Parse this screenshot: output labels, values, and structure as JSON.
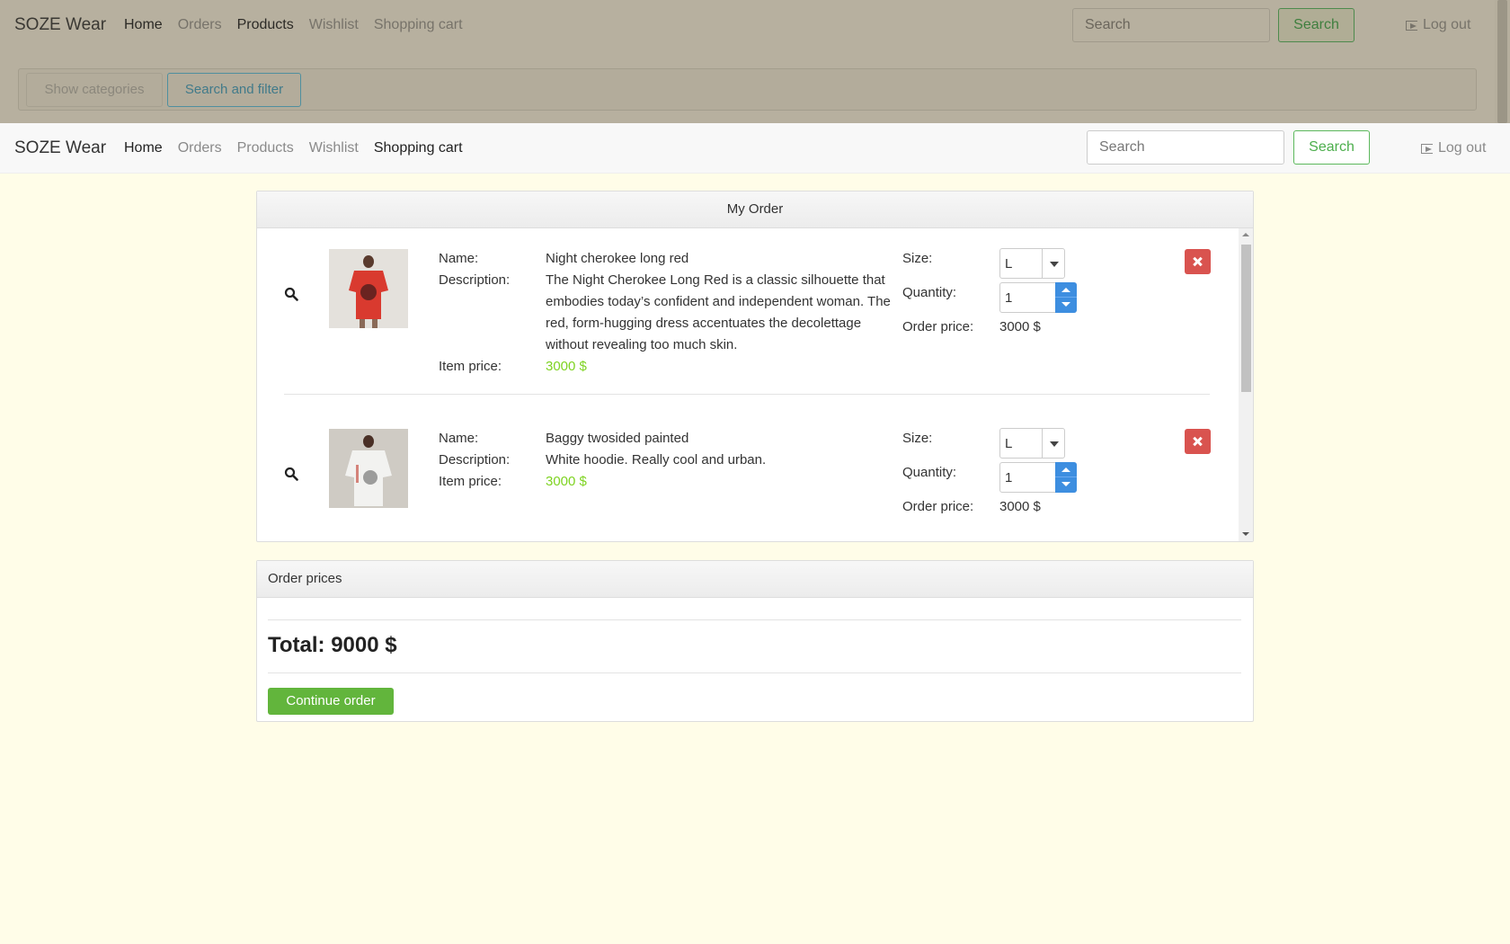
{
  "brand": "SOZE Wear",
  "nav": {
    "home": "Home",
    "orders": "Orders",
    "products": "Products",
    "wishlist": "Wishlist",
    "cart": "Shopping cart",
    "search_placeholder": "Search",
    "search_button": "Search",
    "logout": "Log out"
  },
  "background_filter": {
    "show_categories": "Show categories",
    "search_and_filter": "Search and filter"
  },
  "order": {
    "title": "My Order",
    "labels": {
      "name": "Name:",
      "description": "Description:",
      "item_price": "Item price:",
      "size": "Size:",
      "quantity": "Quantity:",
      "order_price": "Order price:"
    },
    "items": [
      {
        "name": "Night cherokee long red",
        "description": "The Night Cherokee Long Red is a classic silhouette that embodies today’s confident and independent woman. The red, form-hugging dress accentuates the decolettage without revealing too much skin.",
        "item_price": "3000 $",
        "size": "L",
        "quantity": "1",
        "order_price": "3000 $",
        "icons": {
          "view": "search-icon",
          "remove": "remove-icon"
        },
        "image_colors": {
          "garment": "#d93a2f",
          "background": "#e4e1dc"
        }
      },
      {
        "name": "Baggy twosided painted",
        "description": "White hoodie. Really cool and urban.",
        "item_price": "3000 $",
        "size": "L",
        "quantity": "1",
        "order_price": "3000 $",
        "icons": {
          "view": "search-icon",
          "remove": "remove-icon"
        },
        "image_colors": {
          "garment": "#f2f2f0",
          "background": "#cfcbc4"
        }
      }
    ]
  },
  "prices": {
    "title": "Order prices",
    "total": "Total: 9000 $",
    "continue_button": "Continue order"
  },
  "colors": {
    "page_background": "#fffde8",
    "price_green": "#7ed321",
    "remove_red": "#d9534f",
    "continue_green": "#62b53c",
    "spinner_blue": "#3d8ee0"
  }
}
